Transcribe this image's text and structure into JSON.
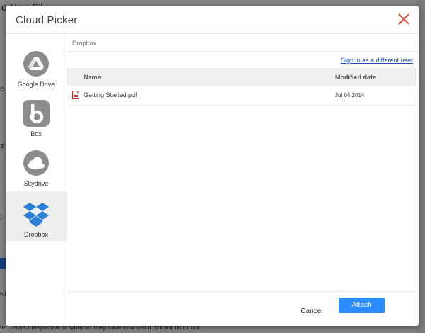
{
  "background": {
    "fragments": [
      "d New Fil",
      "n",
      "c",
      "s",
      "t",
      "Nl",
      "ted users irrespective of whether they have enabled notifications or not"
    ]
  },
  "modal": {
    "title": "Cloud Picker",
    "close_icon": "close-icon"
  },
  "sidebar": {
    "items": [
      {
        "label": "Google Drive",
        "icon": "google-drive-icon"
      },
      {
        "label": "Box",
        "icon": "box-icon"
      },
      {
        "label": "Skydrive",
        "icon": "skydrive-icon"
      },
      {
        "label": "Dropbox",
        "icon": "dropbox-icon",
        "active": true
      }
    ]
  },
  "content": {
    "breadcrumb": "Dropbox",
    "signin_link": "Sign in as a different user",
    "columns": {
      "name": "Name",
      "modified": "Modified date"
    },
    "files": [
      {
        "name": "Getting Started.pdf",
        "modified": "Jul 04 2014",
        "icon": "pdf-file-icon"
      }
    ]
  },
  "footer": {
    "cancel_label": "Cancel",
    "attach_label": "Attach"
  },
  "colors": {
    "accent": "#2d8cff",
    "close": "#e0533d",
    "link": "#1a4fb3",
    "dropbox": "#2a7fd4"
  }
}
